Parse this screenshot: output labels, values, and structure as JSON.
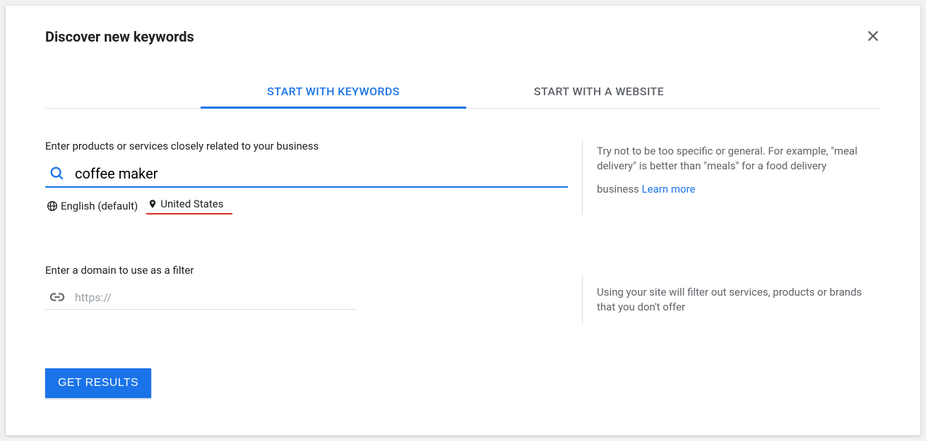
{
  "header": {
    "title": "Discover new keywords"
  },
  "tabs": {
    "keywords": "START WITH KEYWORDS",
    "website": "START WITH A WEBSITE"
  },
  "keyword_section": {
    "label": "Enter products or services closely related to your business",
    "value": "coffee maker",
    "language": "English (default)",
    "location": "United States",
    "hint": "Try not to be too specific or general. For example, \"meal delivery\" is better than \"meals\" for a food delivery business",
    "learn_more": "Learn more"
  },
  "domain_section": {
    "label": "Enter a domain to use as a filter",
    "placeholder": "https://",
    "hint": "Using your site will filter out services, products or brands that you don't offer"
  },
  "submit": {
    "label": "GET RESULTS"
  }
}
